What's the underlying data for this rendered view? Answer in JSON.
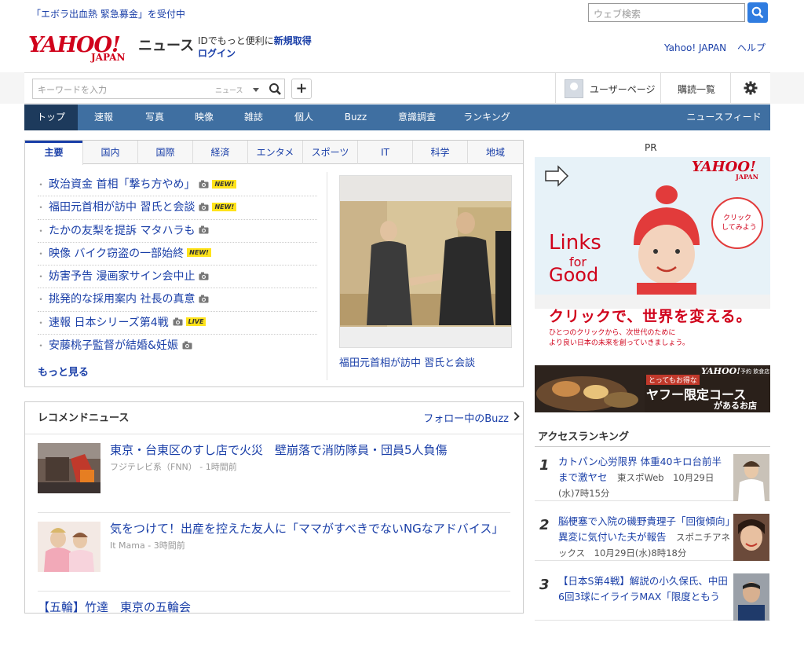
{
  "top": {
    "notice": "「エボラ出血熱 緊急募金」を受付中",
    "web_search_placeholder": "ウェブ検索"
  },
  "header": {
    "logo_word": "YAHOO!",
    "logo_japan": "JAPAN",
    "logo_news": "ニュース",
    "id_text": "IDでもっと便利に",
    "id_register": "新規取得",
    "login": "ログイン",
    "yahoo_japan": "Yahoo! JAPAN",
    "help": "ヘルプ"
  },
  "toolbar": {
    "keyword_placeholder": "キーワードを入力",
    "category": "ニュース",
    "plus": "+",
    "user_page": "ユーザーページ",
    "subscriptions": "購読一覧"
  },
  "nav": {
    "items": [
      "トップ",
      "速報",
      "写真",
      "映像",
      "雑誌",
      "個人",
      "Buzz",
      "意識調査",
      "ランキング"
    ],
    "feed": "ニュースフィード"
  },
  "topics": {
    "tabs": [
      "主要",
      "国内",
      "国際",
      "経済",
      "エンタメ",
      "スポーツ",
      "IT",
      "科学",
      "地域"
    ],
    "items": [
      {
        "title": "政治資金 首相「撃ち方やめ」",
        "badge": "NEW!"
      },
      {
        "title": "福田元首相が訪中 習氏と会談",
        "badge": "NEW!"
      },
      {
        "title": "たかの友梨を提訴 マタハラも",
        "badge": ""
      },
      {
        "title": "映像 バイク窃盗の一部始終",
        "badge": "NEW!"
      },
      {
        "title": "妨害予告 漫画家サイン会中止",
        "badge": ""
      },
      {
        "title": "挑発的な採用案内 社長の真意",
        "badge": ""
      },
      {
        "title": "速報 日本シリーズ第4戦",
        "badge": "LIVE"
      },
      {
        "title": "安藤桃子監督が結婚&妊娠",
        "badge": ""
      }
    ],
    "more": "もっと見る",
    "photo_caption": "福田元首相が訪中 習氏と会談"
  },
  "recommend": {
    "title": "レコメンドニュース",
    "buzz_link": "フォロー中のBuzz",
    "items": [
      {
        "headline": "東京・台東区のすし店で火災　壁崩落で消防隊員・団員5人負傷",
        "meta": "フジテレビ系（FNN） - 1時間前"
      },
      {
        "headline": "気をつけて！出産を控えた友人に「ママがすべきでないNGなアドバイス」",
        "meta": "It Mama - 3時間前"
      },
      {
        "headline": "【五輪】竹達　東京の五輪会",
        "meta": ""
      }
    ]
  },
  "side": {
    "pr": "PR",
    "ad1": {
      "brand": "YAHOO!",
      "brand_sub": "JAPAN",
      "links_line1": "Links",
      "links_line2": "for",
      "links_line3": "Good",
      "bubble_line1": "クリック",
      "bubble_line2": "してみよう",
      "headline": "クリックで、世界を変える。",
      "sub1": "ひとつのクリックから、次世代のために",
      "sub2": "より良い日本の未来を創っていきましょう。"
    },
    "ad2": {
      "brand": "YAHOO!",
      "brand_note": "予約 飲食店",
      "tag": "とってもお得な",
      "line1": "ヤフー限定コース",
      "line2": "があるお店"
    },
    "ranking_title": "アクセスランキング",
    "ranking": [
      {
        "num": "1",
        "text": "カトパン心労限界 体重40キロ台前半まで激ヤセ",
        "src": "東スポWeb　10月29日(水)7時15分"
      },
      {
        "num": "2",
        "text": "脳梗塞で入院の磯野貴理子「回復傾向」異変に気付いた夫が報告",
        "src": "スポニチアネックス　10月29日(水)8時18分"
      },
      {
        "num": "3",
        "text": "【日本S第4戦】解説の小久保氏、中田6回3球にイライラMAX「限度ともう",
        "src": ""
      }
    ]
  },
  "colors": {
    "nav": "#3f6fa1",
    "nav_active": "#1d3a5c",
    "link": "#1a3fa8",
    "brand_red": "#d0021b"
  }
}
